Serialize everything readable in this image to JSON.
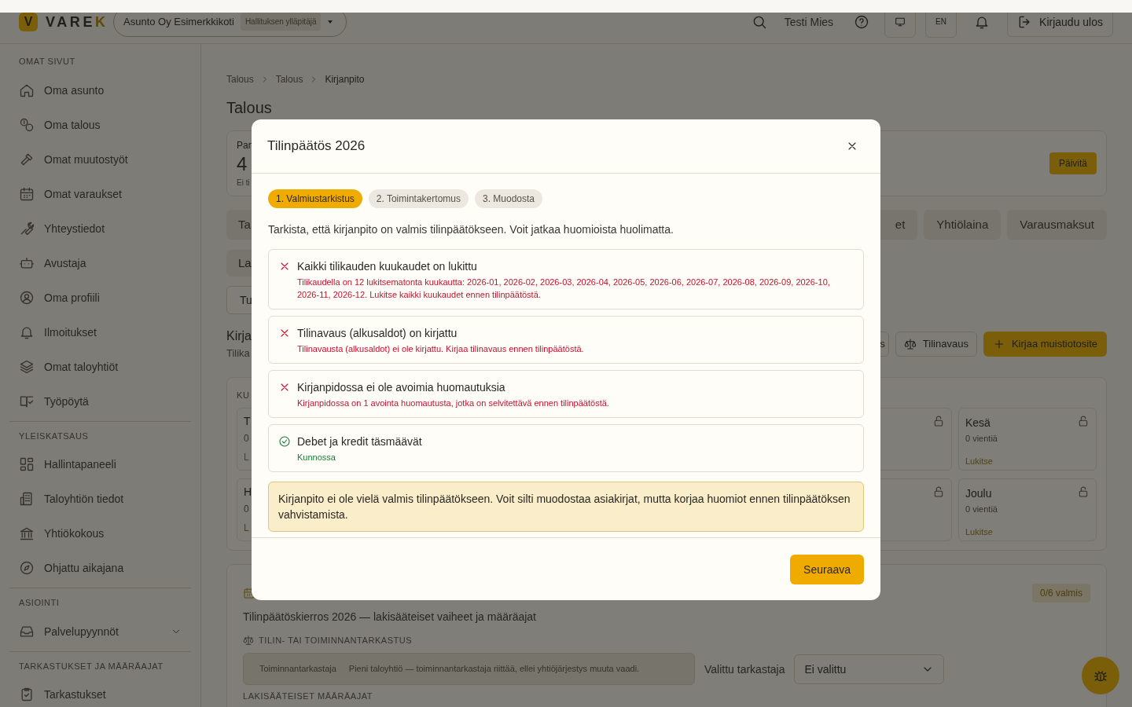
{
  "header": {
    "logo_mark": "V",
    "brand": "VAREK",
    "org_selector": {
      "name": "Asunto Oy Esimerkkikoti",
      "role": "Hallituksen ylläpitäjä"
    },
    "user": "Testi Mies",
    "language": "EN",
    "logout": "Kirjaudu ulos"
  },
  "sidebar": {
    "sections": [
      {
        "title": "OMAT SIVUT",
        "items": [
          {
            "label": "Oma asunto"
          },
          {
            "label": "Oma talous"
          },
          {
            "label": "Omat muutostyöt"
          },
          {
            "label": "Omat varaukset"
          },
          {
            "label": "Yhteystiedot"
          },
          {
            "label": "Avustaja"
          },
          {
            "label": "Oma profiili"
          },
          {
            "label": "Ilmoitukset"
          },
          {
            "label": "Omat taloyhtiöt"
          },
          {
            "label": "Työpöytä"
          }
        ]
      },
      {
        "title": "YLEISKATSAUS",
        "items": [
          {
            "label": "Hallintapaneeli"
          },
          {
            "label": "Taloyhtiön tiedot"
          },
          {
            "label": "Yhtiökokous"
          },
          {
            "label": "Ohjattu aikajana"
          }
        ]
      },
      {
        "title": "ASIOINTI",
        "items": [
          {
            "label": "Palvelupyynnöt",
            "expanded": false
          }
        ]
      },
      {
        "title": "TARKASTUKSET JA MÄÄRÄAJAT",
        "items": [
          {
            "label": "Tarkastukset"
          }
        ]
      }
    ]
  },
  "main": {
    "breadcrumb": [
      "Talous",
      "Talous",
      "Kirjanpito"
    ],
    "title": "Talous",
    "summary_card": {
      "label": "Pan",
      "value": "4",
      "note": "Ei ti",
      "refresh_button": "Päivitä"
    },
    "tabs_left": [
      "Ta"
    ],
    "tabs_right": [
      "et",
      "Yhtiölaina",
      "Varausmaksut"
    ],
    "tabs_row_2": [
      "La"
    ],
    "select": "Tu",
    "ledger": {
      "title": "Kirja",
      "subtitle": "Tilika",
      "buttons": [
        {
          "kind": "partial",
          "label": "s"
        },
        {
          "kind": "opening",
          "label": "Tilinavaus"
        },
        {
          "kind": "primary",
          "label": "Kirjaa muistiotosite"
        }
      ]
    },
    "months": {
      "label": "KU",
      "rows": [
        {
          "left": {
            "title": "T",
            "count": "0",
            "action": "L"
          },
          "right": {
            "title": "Kesä",
            "count": "0 vientiä",
            "action": "Lukitse"
          }
        },
        {
          "left": {
            "title": "H",
            "count": "0",
            "action": "L"
          },
          "right": {
            "title": "Joulu",
            "count": "0 vientiä",
            "action": "Lukitse"
          }
        }
      ]
    },
    "closing_round": {
      "progress": "0/6 valmis",
      "subtitle": "Tilinpäätöskierros 2026 — lakisääteiset vaiheet ja määräajat",
      "audit_heading": "TILIN- TAI TOIMINNANTARKASTUS",
      "audit_type": "Toiminnantarkastaja",
      "audit_note": "Pieni taloyhtiö — toiminnantarkastaja riittää, ellei yhtiöjärjestys muuta vaadi.",
      "auditor_label": "Valittu tarkastaja",
      "auditor_value": "Ei valittu",
      "deadlines_heading": "LAKISÄÄTEISET MÄÄRÄAJAT"
    }
  },
  "modal": {
    "title": "Tilinpäätös 2026",
    "steps": [
      {
        "label": "1. Valmiustarkistus",
        "selected": true
      },
      {
        "label": "2. Toimintakertomus",
        "selected": false
      },
      {
        "label": "3. Muodosta",
        "selected": false
      }
    ],
    "description": "Tarkista, että kirjanpito on valmis tilinpäätökseen. Voit jatkaa huomioista huolimatta.",
    "checks": [
      {
        "kind": "fail",
        "title": "Kaikki tilikauden kuukaudet on lukittu",
        "detail": "Tilikaudella on 12 lukitsematonta kuukautta: 2026-01, 2026-02, 2026-03, 2026-04, 2026-05, 2026-06, 2026-07, 2026-08, 2026-09, 2026-10, 2026-11, 2026-12. Lukitse kaikki kuukaudet ennen tilinpäätöstä."
      },
      {
        "kind": "fail",
        "title": "Tilinavaus (alkusaldot) on kirjattu",
        "detail": "Tilinavausta (alkusaldot) ei ole kirjattu. Kirjaa tilinavaus ennen tilinpäätöstä."
      },
      {
        "kind": "fail",
        "title": "Kirjanpidossa ei ole avoimia huomautuksia",
        "detail": "Kirjanpidossa on 1 avointa huomautusta, jotka on selvitettävä ennen tilinpäätöstä."
      },
      {
        "kind": "pass",
        "title": "Debet ja kredit täsmäävät",
        "detail": "Kunnossa"
      }
    ],
    "alert": "Kirjanpito ei ole vielä valmis tilinpäätökseen. Voit silti muodostaa asiakirjat, mutta korjaa huomiot ennen tilinpäätöksen vahvistamista.",
    "next_button": "Seuraava"
  }
}
